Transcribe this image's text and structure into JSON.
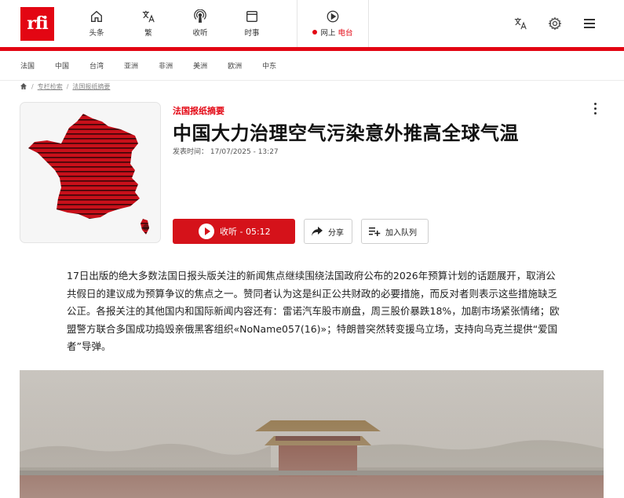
{
  "brand": {
    "logo_text": "rfi",
    "accent": "#e30613"
  },
  "topnav": {
    "items": [
      {
        "label": "头条",
        "icon": "home-icon"
      },
      {
        "label": "繁",
        "icon": "translate-icon"
      },
      {
        "label": "收听",
        "icon": "podcast-icon"
      },
      {
        "label": "时事",
        "icon": "news-icon"
      }
    ],
    "live": {
      "prefix": "网上",
      "suffix": "电台",
      "icon": "play-circle-icon"
    },
    "right_icons": [
      "translate-icon",
      "gear-icon",
      "menu-icon"
    ]
  },
  "regions": [
    "法国",
    "中国",
    "台湾",
    "亚洲",
    "非洲",
    "美洲",
    "欧洲",
    "中东"
  ],
  "breadcrumb": {
    "items": [
      "专栏检索",
      "法国报纸摘要"
    ],
    "home_icon": "home-icon"
  },
  "article": {
    "kicker": "法国报纸摘要",
    "title": "中国大力治理空气污染意外推高全球气温",
    "date": "发表时间： 17/07/2025 - 13:27",
    "listen_label": "收听 - 05:12",
    "share_label": "分享",
    "queue_label": "加入队列",
    "summary": "17日出版的绝大多数法国日报头版关注的新闻焦点继续围绕法国政府公布的2026年预算计划的话题展开，取消公共假日的建议成为预算争议的焦点之一。赞同者认为这是纠正公共财政的必要措施，而反对者则表示这些措施缺乏公正。各报关注的其他国内和国际新闻内容还有：雷诺汽车股市崩盘，周三股价暴跌18%，加剧市场紧张情绪；欧盟警方联合多国成功捣毁亲俄黑客组织«NoName057(16)»；特朗普突然转变援乌立场，支持向乌克兰提供“爱国者”导弹。"
  }
}
